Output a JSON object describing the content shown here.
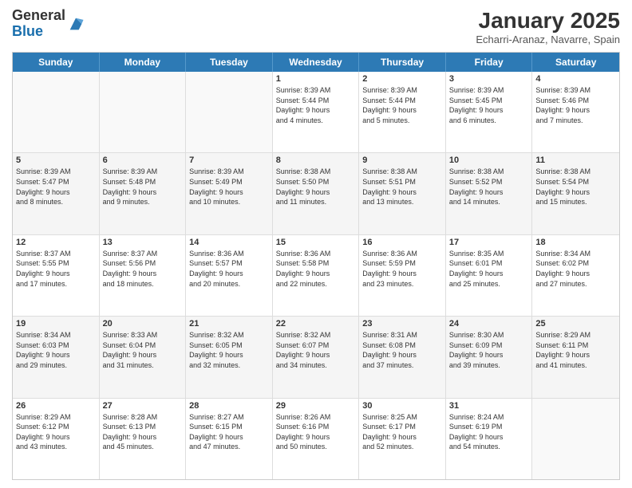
{
  "logo": {
    "line1": "General",
    "line2": "Blue"
  },
  "title": "January 2025",
  "subtitle": "Echarri-Aranaz, Navarre, Spain",
  "days": [
    "Sunday",
    "Monday",
    "Tuesday",
    "Wednesday",
    "Thursday",
    "Friday",
    "Saturday"
  ],
  "weeks": [
    [
      {
        "day": "",
        "text": ""
      },
      {
        "day": "",
        "text": ""
      },
      {
        "day": "",
        "text": ""
      },
      {
        "day": "1",
        "text": "Sunrise: 8:39 AM\nSunset: 5:44 PM\nDaylight: 9 hours\nand 4 minutes."
      },
      {
        "day": "2",
        "text": "Sunrise: 8:39 AM\nSunset: 5:44 PM\nDaylight: 9 hours\nand 5 minutes."
      },
      {
        "day": "3",
        "text": "Sunrise: 8:39 AM\nSunset: 5:45 PM\nDaylight: 9 hours\nand 6 minutes."
      },
      {
        "day": "4",
        "text": "Sunrise: 8:39 AM\nSunset: 5:46 PM\nDaylight: 9 hours\nand 7 minutes."
      }
    ],
    [
      {
        "day": "5",
        "text": "Sunrise: 8:39 AM\nSunset: 5:47 PM\nDaylight: 9 hours\nand 8 minutes."
      },
      {
        "day": "6",
        "text": "Sunrise: 8:39 AM\nSunset: 5:48 PM\nDaylight: 9 hours\nand 9 minutes."
      },
      {
        "day": "7",
        "text": "Sunrise: 8:39 AM\nSunset: 5:49 PM\nDaylight: 9 hours\nand 10 minutes."
      },
      {
        "day": "8",
        "text": "Sunrise: 8:38 AM\nSunset: 5:50 PM\nDaylight: 9 hours\nand 11 minutes."
      },
      {
        "day": "9",
        "text": "Sunrise: 8:38 AM\nSunset: 5:51 PM\nDaylight: 9 hours\nand 13 minutes."
      },
      {
        "day": "10",
        "text": "Sunrise: 8:38 AM\nSunset: 5:52 PM\nDaylight: 9 hours\nand 14 minutes."
      },
      {
        "day": "11",
        "text": "Sunrise: 8:38 AM\nSunset: 5:54 PM\nDaylight: 9 hours\nand 15 minutes."
      }
    ],
    [
      {
        "day": "12",
        "text": "Sunrise: 8:37 AM\nSunset: 5:55 PM\nDaylight: 9 hours\nand 17 minutes."
      },
      {
        "day": "13",
        "text": "Sunrise: 8:37 AM\nSunset: 5:56 PM\nDaylight: 9 hours\nand 18 minutes."
      },
      {
        "day": "14",
        "text": "Sunrise: 8:36 AM\nSunset: 5:57 PM\nDaylight: 9 hours\nand 20 minutes."
      },
      {
        "day": "15",
        "text": "Sunrise: 8:36 AM\nSunset: 5:58 PM\nDaylight: 9 hours\nand 22 minutes."
      },
      {
        "day": "16",
        "text": "Sunrise: 8:36 AM\nSunset: 5:59 PM\nDaylight: 9 hours\nand 23 minutes."
      },
      {
        "day": "17",
        "text": "Sunrise: 8:35 AM\nSunset: 6:01 PM\nDaylight: 9 hours\nand 25 minutes."
      },
      {
        "day": "18",
        "text": "Sunrise: 8:34 AM\nSunset: 6:02 PM\nDaylight: 9 hours\nand 27 minutes."
      }
    ],
    [
      {
        "day": "19",
        "text": "Sunrise: 8:34 AM\nSunset: 6:03 PM\nDaylight: 9 hours\nand 29 minutes."
      },
      {
        "day": "20",
        "text": "Sunrise: 8:33 AM\nSunset: 6:04 PM\nDaylight: 9 hours\nand 31 minutes."
      },
      {
        "day": "21",
        "text": "Sunrise: 8:32 AM\nSunset: 6:05 PM\nDaylight: 9 hours\nand 32 minutes."
      },
      {
        "day": "22",
        "text": "Sunrise: 8:32 AM\nSunset: 6:07 PM\nDaylight: 9 hours\nand 34 minutes."
      },
      {
        "day": "23",
        "text": "Sunrise: 8:31 AM\nSunset: 6:08 PM\nDaylight: 9 hours\nand 37 minutes."
      },
      {
        "day": "24",
        "text": "Sunrise: 8:30 AM\nSunset: 6:09 PM\nDaylight: 9 hours\nand 39 minutes."
      },
      {
        "day": "25",
        "text": "Sunrise: 8:29 AM\nSunset: 6:11 PM\nDaylight: 9 hours\nand 41 minutes."
      }
    ],
    [
      {
        "day": "26",
        "text": "Sunrise: 8:29 AM\nSunset: 6:12 PM\nDaylight: 9 hours\nand 43 minutes."
      },
      {
        "day": "27",
        "text": "Sunrise: 8:28 AM\nSunset: 6:13 PM\nDaylight: 9 hours\nand 45 minutes."
      },
      {
        "day": "28",
        "text": "Sunrise: 8:27 AM\nSunset: 6:15 PM\nDaylight: 9 hours\nand 47 minutes."
      },
      {
        "day": "29",
        "text": "Sunrise: 8:26 AM\nSunset: 6:16 PM\nDaylight: 9 hours\nand 50 minutes."
      },
      {
        "day": "30",
        "text": "Sunrise: 8:25 AM\nSunset: 6:17 PM\nDaylight: 9 hours\nand 52 minutes."
      },
      {
        "day": "31",
        "text": "Sunrise: 8:24 AM\nSunset: 6:19 PM\nDaylight: 9 hours\nand 54 minutes."
      },
      {
        "day": "",
        "text": ""
      }
    ]
  ]
}
